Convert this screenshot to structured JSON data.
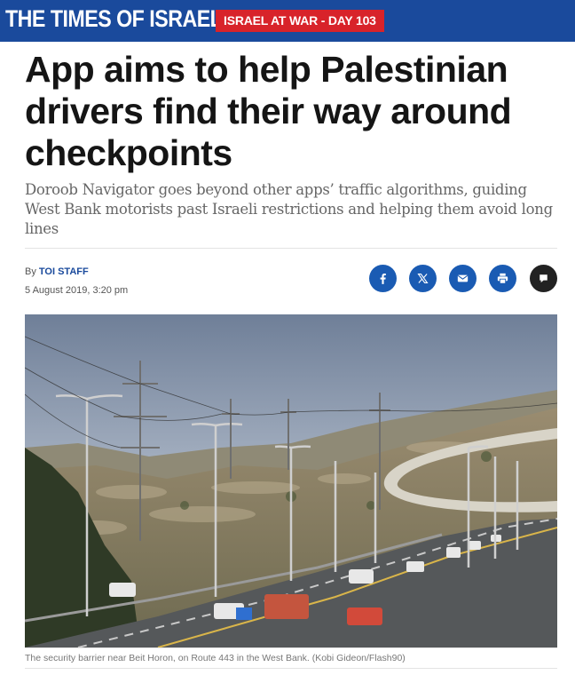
{
  "header": {
    "logo": "THE TIMES OF ISRAEL",
    "badge": "ISRAEL AT WAR - DAY 103"
  },
  "article": {
    "title": "App aims to help Palestinian drivers find their way around checkpoints",
    "subtitle": "Doroob Navigator goes beyond other apps’ traffic algorithms, guiding West Bank motorists past Israeli restrictions and helping them avoid long lines",
    "byline_prefix": "By ",
    "author": "TOI STAFF",
    "date": "5 August 2019, 3:20 pm",
    "photo_caption": "The security barrier near Beit Horon, on Route 443 in the West Bank. (Kobi Gideon/Flash90)"
  },
  "share_buttons": [
    "facebook-icon",
    "x-icon",
    "email-icon",
    "print-icon",
    "comment-icon"
  ],
  "colors": {
    "brand_blue": "#1a4a9c",
    "badge_red": "#d8232a",
    "share_blue": "#1a5bb3"
  }
}
